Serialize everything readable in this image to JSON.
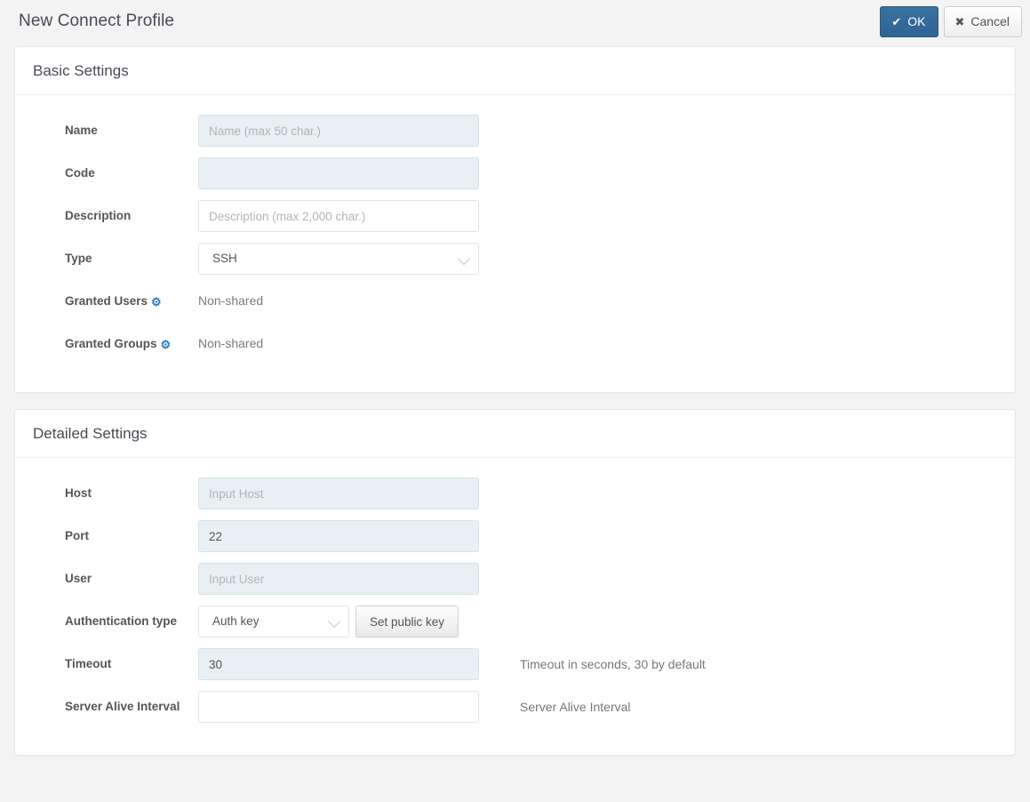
{
  "header": {
    "title": "New Connect Profile",
    "ok_label": "OK",
    "ok_icon": "check-icon",
    "cancel_label": "Cancel",
    "cancel_icon": "close-icon",
    "accent_color": "#336699"
  },
  "basic_settings": {
    "title": "Basic Settings",
    "name": {
      "label": "Name",
      "value": "",
      "placeholder": "Name (max 50 char.)"
    },
    "code": {
      "label": "Code",
      "value": "",
      "placeholder": ""
    },
    "description": {
      "label": "Description",
      "value": "",
      "placeholder": "Description (max 2,000 char.)"
    },
    "type": {
      "label": "Type",
      "value": "SSH"
    },
    "granted_users": {
      "label": "Granted Users",
      "icon": "gear-icon",
      "value": "Non-shared"
    },
    "granted_groups": {
      "label": "Granted Groups",
      "icon": "gear-icon",
      "value": "Non-shared"
    }
  },
  "detailed_settings": {
    "title": "Detailed Settings",
    "host": {
      "label": "Host",
      "value": "",
      "placeholder": "Input Host"
    },
    "port": {
      "label": "Port",
      "value": "22",
      "placeholder": ""
    },
    "user": {
      "label": "User",
      "value": "",
      "placeholder": "Input User"
    },
    "auth_type": {
      "label": "Authentication type",
      "value": "Auth key",
      "button_label": "Set public key"
    },
    "timeout": {
      "label": "Timeout",
      "value": "30",
      "placeholder": "",
      "help": "Timeout in seconds, 30 by default"
    },
    "server_alive_interval": {
      "label": "Server Alive Interval",
      "value": "",
      "placeholder": "",
      "help": "Server Alive Interval"
    }
  }
}
